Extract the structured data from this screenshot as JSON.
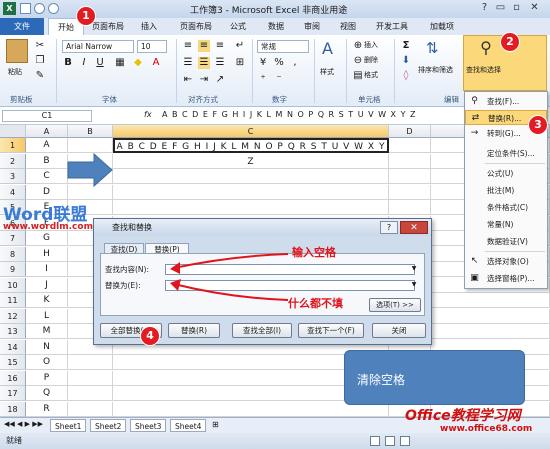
{
  "window": {
    "title": "工作簿3 - Microsoft Excel 非商业用途",
    "help": "?"
  },
  "ribbon_tabs": [
    "文件",
    "开始",
    "页面布局",
    "插入",
    "页面布局",
    "公式",
    "数据",
    "审阅",
    "视图",
    "开发工具",
    "加载项"
  ],
  "ribbon_tabs_visible": {
    "file": "文件",
    "home": "开始",
    "insert_layout": "页面布局",
    "insert": "插入",
    "page_layout": "页面布局",
    "formula": "公式",
    "data": "数据",
    "review": "审阅",
    "view": "视图",
    "dev": "开发工具",
    "addins": "加载项"
  },
  "ribbon": {
    "paste": "粘贴",
    "clipboard": "剪贴板",
    "font_name": "Arial Narrow",
    "font_size": "10",
    "font_group": "字体",
    "bold": "B",
    "italic": "I",
    "underline": "U",
    "align_group": "对齐方式",
    "number_format": "常规",
    "number_group": "数字",
    "styles": "样式",
    "insert": "插入",
    "delete": "删除",
    "format": "格式",
    "cells_group": "单元格",
    "sort_filter": "排序和筛选",
    "find_select": "查找和选择",
    "editing": "编辑"
  },
  "formula_bar": {
    "name_box": "C1",
    "fx": "fx",
    "content": "A B C D E F G H I J K L M N O P Q R S T U V W X Y Z"
  },
  "columns": [
    "A",
    "B",
    "C",
    "D",
    "E"
  ],
  "rows": [
    "1",
    "2",
    "3",
    "4",
    "5",
    "6",
    "7",
    "8",
    "9",
    "10",
    "11",
    "12",
    "13",
    "14",
    "15",
    "16",
    "17",
    "18"
  ],
  "col_a_values": [
    "A",
    "B",
    "C",
    "D",
    "E",
    "F",
    "G",
    "H",
    "I",
    "J",
    "K",
    "L",
    "M",
    "N",
    "O",
    "P",
    "Q",
    "R"
  ],
  "c1_value": "A B C D E F G H I J K L M N O P Q R S T U V W X Y Z",
  "watermark": {
    "logo": "Word联盟",
    "url": "www.wordlm.com",
    "office_logo": "Office教程学习网",
    "office_url": "www.office68.com"
  },
  "dialog": {
    "title": "查找和替换",
    "tab_find": "查找(D)",
    "tab_replace": "替换(P)",
    "find_label": "查找内容(N):",
    "replace_label": "替换为(E):",
    "options": "选项(T) >>",
    "replace_all": "全部替换(A)",
    "replace": "替换(R)",
    "find_all": "查找全部(I)",
    "find_next": "查找下一个(F)",
    "close": "关闭",
    "help": "?"
  },
  "menu": {
    "items": [
      "查找(F)...",
      "替换(R)...",
      "转到(G)...",
      "定位条件(S)...",
      "公式(U)",
      "批注(M)",
      "条件格式(C)",
      "常量(N)",
      "数据验证(V)",
      "选择对象(O)",
      "选择窗格(P)..."
    ]
  },
  "annotations": {
    "input_space": "输入空格",
    "fill_nothing": "什么都不填",
    "clear_space": "清除空格",
    "badge1": "1",
    "badge2": "2",
    "badge3": "3",
    "badge4": "4"
  },
  "sheets": [
    "Sheet1",
    "Sheet2",
    "Sheet3",
    "Sheet4"
  ],
  "status": {
    "ready": "就绪"
  }
}
